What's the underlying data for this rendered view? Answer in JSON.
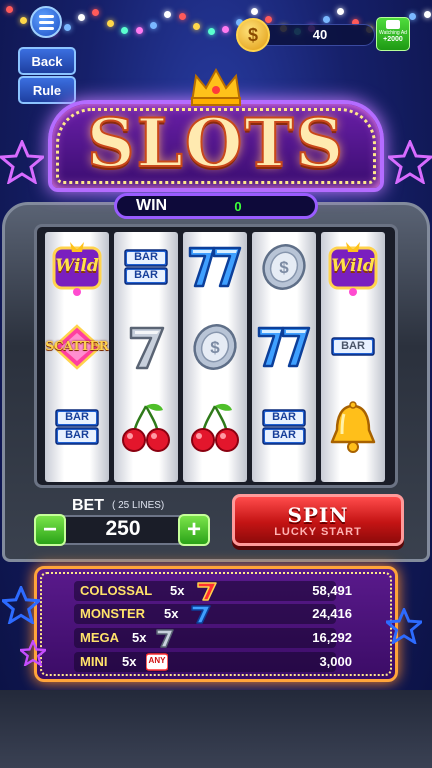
{
  "header": {
    "coins": "40",
    "watch_ad_label": "Watching Ad",
    "watch_ad_reward": "+2000"
  },
  "side_buttons": {
    "back_label": "Back",
    "rule_label": "Rule"
  },
  "title": "SLOTS",
  "win": {
    "label": "WIN",
    "value": "0"
  },
  "reels": [
    [
      "wild",
      "scatter",
      "bar-double"
    ],
    [
      "bar-double",
      "seven-silver",
      "cherry"
    ],
    [
      "seven-blue-double",
      "silver-coin",
      "cherry"
    ],
    [
      "silver-coin",
      "seven-blue-double",
      "bar-double"
    ],
    [
      "wild",
      "bar-single",
      "bell"
    ]
  ],
  "symbol_text": {
    "wild": "Wild",
    "scatter": "SCATTER",
    "bar": "BAR"
  },
  "bet": {
    "label": "BET",
    "lines": "( 25 LINES)",
    "value": "250",
    "minus": "−",
    "plus": "+"
  },
  "spin": {
    "label": "SPIN",
    "sublabel": "LUCKY START"
  },
  "jackpots": [
    {
      "name": "COLOSSAL",
      "mult": "5x",
      "symbol": "seven-red",
      "value": "58,491"
    },
    {
      "name": "MONSTER",
      "mult": "5x",
      "symbol": "seven-blue",
      "value": "24,416"
    },
    {
      "name": "MEGA",
      "mult": "5x",
      "symbol": "seven-silver",
      "value": "16,292"
    },
    {
      "name": "MINI",
      "mult": "5x",
      "symbol": "any",
      "value": "3,000"
    }
  ],
  "jackpot_symbol_text": {
    "any": "ANY"
  },
  "colors": {
    "accent_green": "#3dff3a",
    "jackpot_gold": "#ffe26a",
    "spin_red": "#c41414"
  }
}
